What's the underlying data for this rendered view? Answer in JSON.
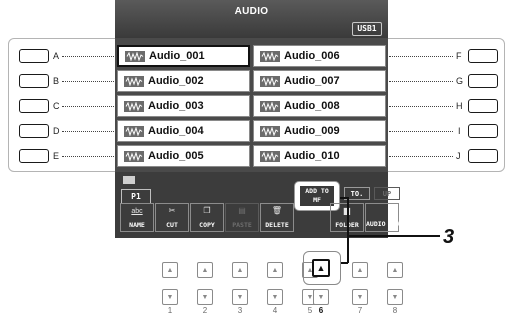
{
  "header": {
    "title": "AUDIO",
    "drive_tab": "USB1"
  },
  "files_left": [
    "Audio_001",
    "Audio_002",
    "Audio_003",
    "Audio_004",
    "Audio_005"
  ],
  "files_right": [
    "Audio_006",
    "Audio_007",
    "Audio_008",
    "Audio_009",
    "Audio_010"
  ],
  "selected_file_index": 0,
  "side_labels_left": [
    "A",
    "B",
    "C",
    "D",
    "E"
  ],
  "side_labels_right": [
    "F",
    "G",
    "H",
    "I",
    "J"
  ],
  "page_indicator": "P1",
  "menu": {
    "name": "NAME",
    "name_hint": "abc",
    "cut": "CUT",
    "copy": "COPY",
    "paste": "PASTE",
    "delete": "DELETE",
    "add_to_mf": "ADD TO\nMF",
    "folder": "FOLDER",
    "audio_play": "AUDIO\nPLAY",
    "up": "UP",
    "to": "TO."
  },
  "panel_numbers": [
    "1",
    "2",
    "3",
    "4",
    "5",
    "6",
    "7",
    "8"
  ],
  "active_panel_index": 5,
  "step_callout": "3",
  "colors": {
    "lcd": "#3c3c3c",
    "frame": "#b4b4b4",
    "text_on_lcd": "#ffffff"
  },
  "icons": {
    "file": "audio-waveform-icon",
    "up_button": "triangle-up-icon",
    "down_button": "triangle-down-icon"
  }
}
